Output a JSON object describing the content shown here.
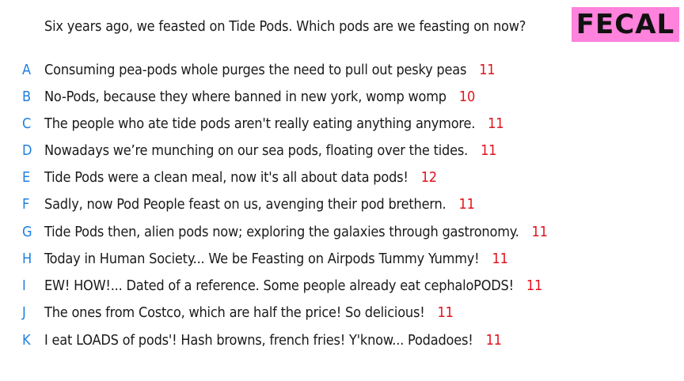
{
  "question": "Six years ago, we feasted on Tide Pods. Which pods are we feasting on now?",
  "badge": "FECAL",
  "colors": {
    "letter": "#1f7fe0",
    "score": "#e0141e",
    "badge_bg": "#ff82dc"
  },
  "answers": [
    {
      "letter": "A",
      "text": "Consuming pea-pods whole purges the need to pull out pesky peas",
      "score": "11"
    },
    {
      "letter": "B",
      "text": "No-Pods, because they where banned in new york, womp womp",
      "score": "10"
    },
    {
      "letter": "C",
      "text": "The people who ate tide pods aren't really eating anything anymore.",
      "score": "11"
    },
    {
      "letter": "D",
      "text": "Nowadays we’re munching on our sea pods, floating over the tides.",
      "score": "11"
    },
    {
      "letter": "E",
      "text": "Tide Pods were a clean meal, now it's all about data pods!",
      "score": "12"
    },
    {
      "letter": "F",
      "text": "Sadly, now Pod People feast on us, avenging their pod brethern.",
      "score": "11"
    },
    {
      "letter": "G",
      "text": "Tide Pods then, alien pods now; exploring the galaxies through gastronomy.",
      "score": "11"
    },
    {
      "letter": "H",
      "text": "Today in Human Society... We be Feasting on Airpods Tummy Yummy!",
      "score": "11"
    },
    {
      "letter": "I",
      "text": "EW! HOW!... Dated of a reference. Some people already eat cephaloPODS!",
      "score": "11"
    },
    {
      "letter": "J",
      "text": "The ones from Costco, which are half the price! So delicious!",
      "score": "11"
    },
    {
      "letter": "K",
      "text": "I eat LOADS of pods'! Hash browns, french fries! Y'know... Podadoes!",
      "score": "11"
    }
  ]
}
